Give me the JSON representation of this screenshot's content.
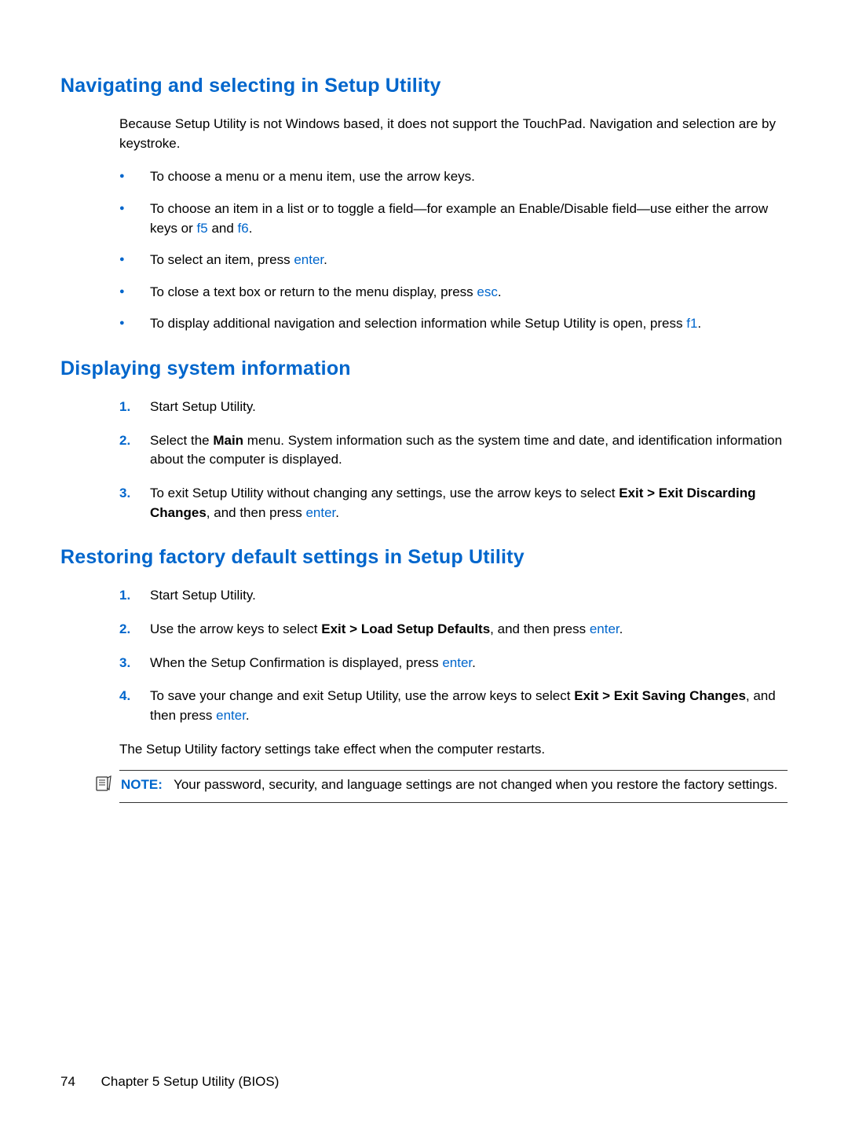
{
  "section1": {
    "heading": "Navigating and selecting in Setup Utility",
    "intro": "Because Setup Utility is not Windows based, it does not support the TouchPad. Navigation and selection are by keystroke.",
    "bullets": {
      "b1": "To choose a menu or a menu item, use the arrow keys.",
      "b2_pre": "To choose an item in a list or to toggle a field—for example an Enable/Disable field—use either the arrow keys or ",
      "b2_k1": "f5",
      "b2_mid": " and ",
      "b2_k2": "f6",
      "b2_post": ".",
      "b3_pre": "To select an item, press ",
      "b3_k": "enter",
      "b3_post": ".",
      "b4_pre": "To close a text box or return to the menu display, press ",
      "b4_k": "esc",
      "b4_post": ".",
      "b5_pre": "To display additional navigation and selection information while Setup Utility is open, press ",
      "b5_k": "f1",
      "b5_post": "."
    }
  },
  "section2": {
    "heading": "Displaying system information",
    "items": {
      "n1": "1.",
      "t1": "Start Setup Utility.",
      "n2": "2.",
      "t2_pre": "Select the ",
      "t2_bold": "Main",
      "t2_post": " menu. System information such as the system time and date, and identification information about the computer is displayed.",
      "n3": "3.",
      "t3_pre": "To exit Setup Utility without changing any settings, use the arrow keys to select ",
      "t3_bold": "Exit > Exit Discarding Changes",
      "t3_mid": ", and then press ",
      "t3_k": "enter",
      "t3_post": "."
    }
  },
  "section3": {
    "heading": "Restoring factory default settings in Setup Utility",
    "items": {
      "n1": "1.",
      "t1": "Start Setup Utility.",
      "n2": "2.",
      "t2_pre": "Use the arrow keys to select ",
      "t2_bold": "Exit > Load Setup Defaults",
      "t2_mid": ", and then press ",
      "t2_k": "enter",
      "t2_post": ".",
      "n3": "3.",
      "t3_pre": "When the Setup Confirmation is displayed, press ",
      "t3_k": "enter",
      "t3_post": ".",
      "n4": "4.",
      "t4_pre": "To save your change and exit Setup Utility, use the arrow keys to select ",
      "t4_bold": "Exit > Exit Saving Changes",
      "t4_mid": ", and then press ",
      "t4_k": "enter",
      "t4_post": "."
    },
    "after": "The Setup Utility factory settings take effect when the computer restarts.",
    "note_label": "NOTE:",
    "note_text": "Your password, security, and language settings are not changed when you restore the factory settings."
  },
  "footer": {
    "page": "74",
    "chapter": "Chapter 5   Setup Utility (BIOS)"
  }
}
